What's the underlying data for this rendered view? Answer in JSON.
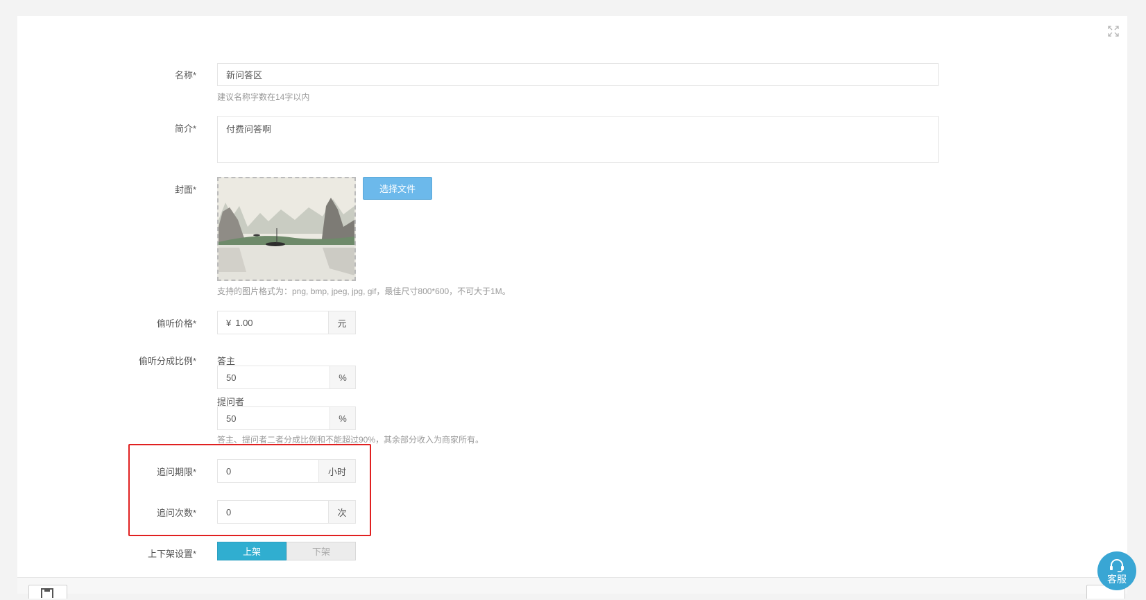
{
  "form": {
    "name": {
      "label": "名称*",
      "value": "新问答区",
      "help": "建议名称字数在14字以内"
    },
    "intro": {
      "label": "简介*",
      "value": "付费问答啊"
    },
    "cover": {
      "label": "封面*",
      "button": "选择文件",
      "help": "支持的图片格式为：png, bmp, jpeg, jpg, gif，最佳尺寸800*600，不可大于1M。"
    },
    "listen_price": {
      "label": "偷听价格*",
      "prefix": "¥",
      "value": "1.00",
      "unit": "元"
    },
    "split": {
      "label": "偷听分成比例*",
      "answerer_label": "答主",
      "answerer_value": "50",
      "answerer_unit": "%",
      "asker_label": "提问者",
      "asker_value": "50",
      "asker_unit": "%",
      "help": "答主、提问者二者分成比例和不能超过90%，其余部分收入为商家所有。"
    },
    "followup_period": {
      "label": "追问期限*",
      "value": "0",
      "unit": "小时"
    },
    "followup_count": {
      "label": "追问次数*",
      "value": "0",
      "unit": "次"
    },
    "shelf": {
      "label": "上下架设置*",
      "on": "上架",
      "off": "下架"
    }
  },
  "support": {
    "label": "客服"
  },
  "colors": {
    "accent": "#30aed0",
    "highlight": "#e02020",
    "file_button": "#6cb9eb"
  },
  "icons": {
    "expand": "expand-icon",
    "support": "headset-icon"
  }
}
